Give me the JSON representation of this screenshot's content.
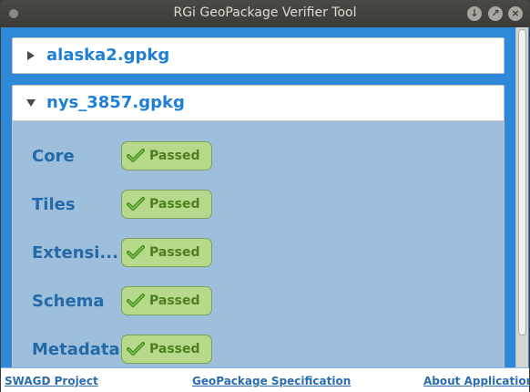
{
  "window": {
    "title": "RGi GeoPackage Verifier Tool"
  },
  "files": [
    {
      "name": "alaska2.gpkg",
      "expanded": false
    },
    {
      "name": "nys_3857.gpkg",
      "expanded": true
    }
  ],
  "checks": [
    {
      "label": "Core",
      "status": "Passed"
    },
    {
      "label": "Tiles",
      "status": "Passed"
    },
    {
      "label": "Extensi...",
      "status": "Passed"
    },
    {
      "label": "Schema",
      "status": "Passed"
    },
    {
      "label": "Metadata",
      "status": "Passed"
    }
  ],
  "footer": {
    "link1": "SWAGD Project",
    "link2": "GeoPackage Specification",
    "link3": "About Application"
  },
  "icons": {
    "collapsed": "triangle-right-icon",
    "expanded": "triangle-down-icon",
    "check": "check-icon",
    "minimize": "minimize-icon",
    "maximize": "maximize-icon",
    "close": "close-icon"
  },
  "colors": {
    "accent": "#2e8ad9",
    "file_name": "#1f7fd6",
    "check_label": "#2469a8",
    "passed_bg": "#b7d98b",
    "passed_text": "#4c7f1f"
  }
}
